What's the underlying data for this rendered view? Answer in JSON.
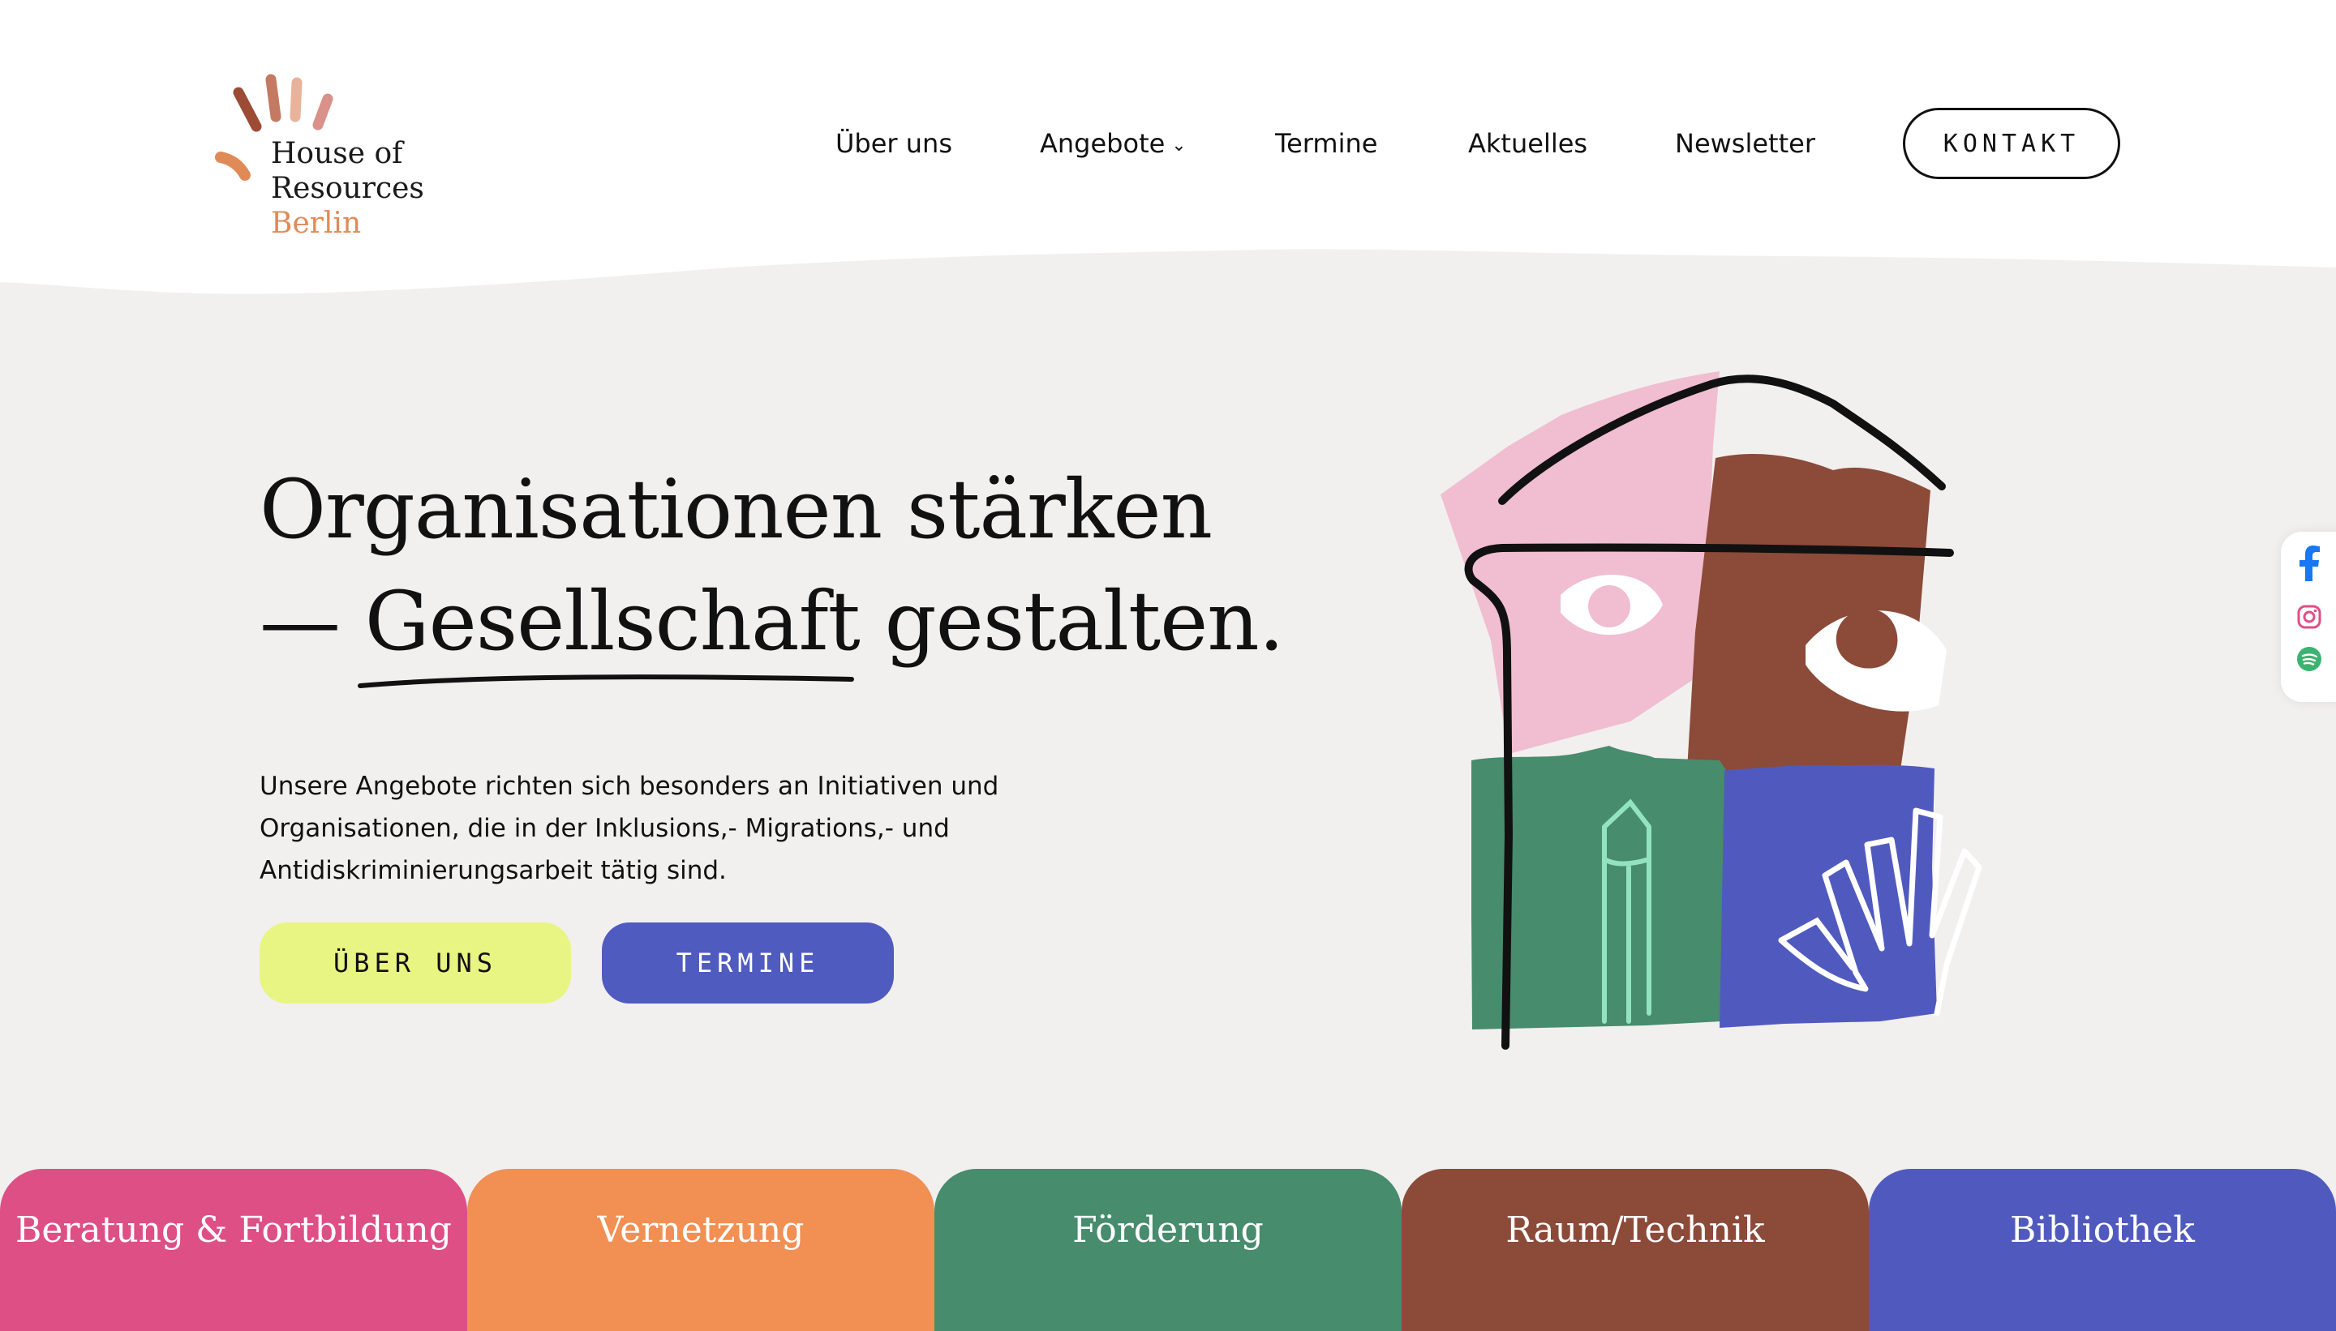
{
  "logo": {
    "line1": "House of",
    "line2": "Resources",
    "line3": "Berlin",
    "colors": [
      "#9c4b35",
      "#c47a62",
      "#e8b39a",
      "#d9918a",
      "#e08a57"
    ]
  },
  "nav": {
    "items": [
      {
        "label": "Über uns"
      },
      {
        "label": "Angebote",
        "caret": "⌄"
      },
      {
        "label": "Termine"
      },
      {
        "label": "Aktuelles"
      },
      {
        "label": "Newsletter"
      }
    ],
    "contact_label": "KONTAKT"
  },
  "hero": {
    "title_line1": "Organisationen stärken",
    "title_line2": "— Gesellschaft gestalten.",
    "text": "Unsere Angebote richten sich besonders an Initiativen und Organisationen, die in der Inklusions,- Migrations,- und Antidiskriminierungsarbeit tätig sind.",
    "button_about": "ÜBER UNS",
    "button_events": "TERMINE"
  },
  "social": {
    "icons": [
      "facebook-icon",
      "instagram-icon",
      "spotify-icon"
    ]
  },
  "tiles": [
    {
      "label": "Beratung & Fortbildung",
      "color": "#de4f86"
    },
    {
      "label": "Vernetzung",
      "color": "#f28f53"
    },
    {
      "label": "Förderung",
      "color": "#468c6d"
    },
    {
      "label": "Raum/Technik",
      "color": "#8c4a39"
    },
    {
      "label": "Bibliothek",
      "color": "#505abe"
    }
  ],
  "colors": {
    "background": "#f2efef",
    "header": "#ffffff",
    "accent_yellow": "#e9f582",
    "accent_blue": "#4f5bbf"
  }
}
